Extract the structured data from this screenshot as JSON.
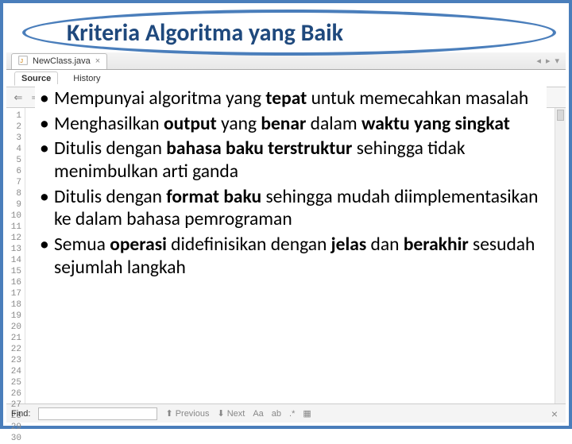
{
  "title": "Kriteria Algoritma yang Baik",
  "ide": {
    "file_tab": "NewClass.java",
    "subtabs": {
      "source": "Source",
      "history": "History"
    },
    "find": {
      "label": "Find:",
      "previous": "Previous",
      "next": "Next"
    },
    "line_count": 30
  },
  "bullets": [
    {
      "pre": "Mempunyai algoritma yang ",
      "b1": "tepat",
      "post1": " untuk memecahkan masalah"
    },
    {
      "pre": "Menghasilkan ",
      "b1": "output",
      "mid1": " yang ",
      "b2": "benar",
      "mid2": " dalam ",
      "b3": "waktu yang singkat"
    },
    {
      "pre": "Ditulis dengan ",
      "b1": "bahasa baku terstruktur",
      "post1": " sehingga tidak menimbulkan arti ganda"
    },
    {
      "pre": "Ditulis dengan ",
      "b1": "format baku",
      "post1": " sehingga mudah diimplementasikan ke dalam bahasa pemrograman"
    },
    {
      "pre": "Semua ",
      "b1": "operasi",
      "mid1": " didefinisikan dengan ",
      "b2": "jelas",
      "mid2": " dan ",
      "b3": "berakhir",
      "post1": " sesudah sejumlah langkah"
    }
  ]
}
